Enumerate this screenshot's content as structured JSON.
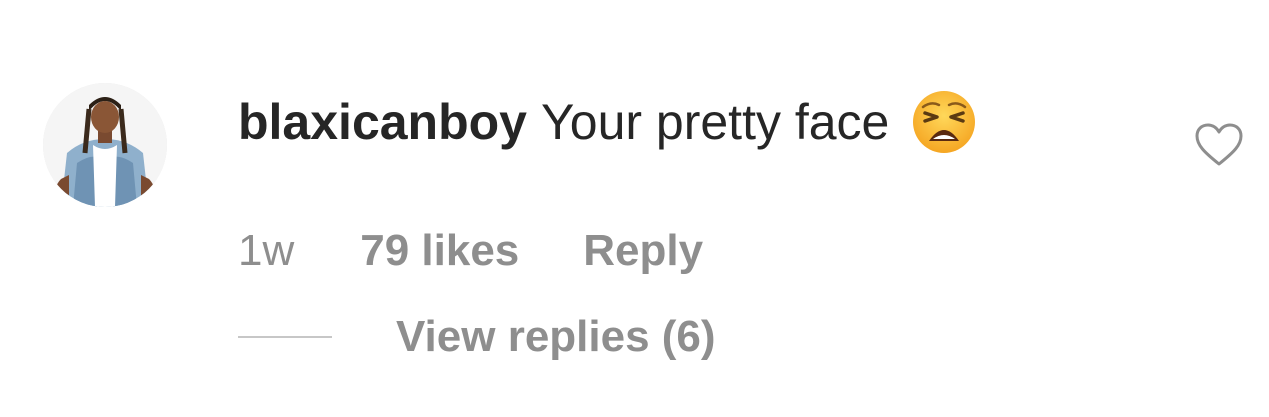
{
  "comment": {
    "username": "blaxicanboy",
    "text": "Your pretty face",
    "emoji_icon": "weary-face-emoji-icon",
    "timestamp": "1w",
    "likes": "79 likes",
    "reply_label": "Reply",
    "view_replies_label": "View replies (6)"
  },
  "icons": {
    "like": "heart-outline-icon"
  },
  "colors": {
    "primary_text": "#262626",
    "secondary_text": "#8e8e8e",
    "divider": "#c7c7c7"
  }
}
